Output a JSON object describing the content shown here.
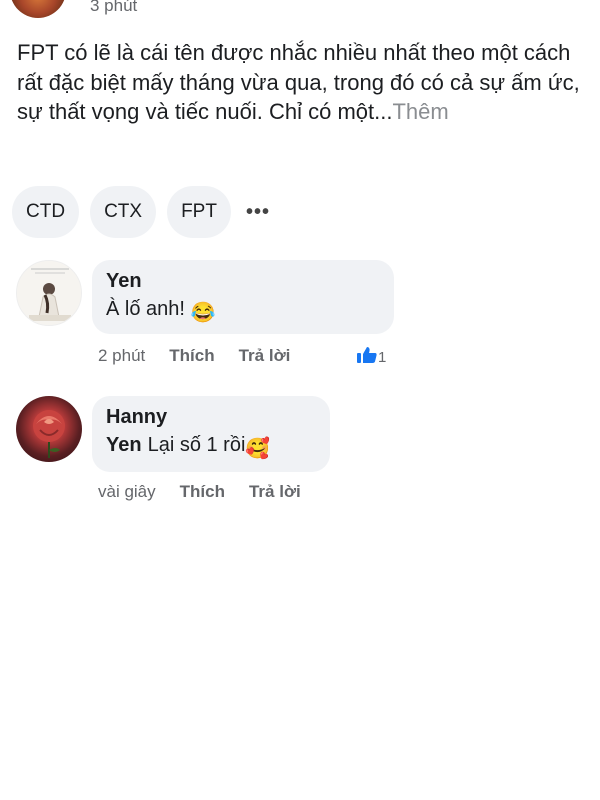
{
  "post": {
    "time": "3 phút",
    "text": "FPT có lẽ là cái tên được nhắc nhiều nhất theo một cách rất đặc biệt mấy tháng vừa qua, trong đó có cả sự ấm ức, sự thất vọng và tiếc nuối. Chỉ có một...",
    "more_label": "Thêm"
  },
  "tags": [
    "CTD",
    "CTX",
    "FPT"
  ],
  "more_tags_label": "•••",
  "comments": [
    {
      "author": "Yen",
      "text": "À lố anh!",
      "emoji": "😂",
      "time": "2 phút",
      "like_label": "Thích",
      "reply_label": "Trả lời",
      "reaction_count": "1",
      "reaction_icon": "thumbs-up-icon"
    },
    {
      "author": "Hanny",
      "mention": "Yen",
      "text": "Lại số 1 rồi",
      "emoji": "🥰",
      "time": "vài giây",
      "like_label": "Thích",
      "reply_label": "Trả lời"
    }
  ],
  "colors": {
    "bubble": "#f0f2f5",
    "meta_text": "#65676b",
    "like_blue": "#1877f2"
  }
}
